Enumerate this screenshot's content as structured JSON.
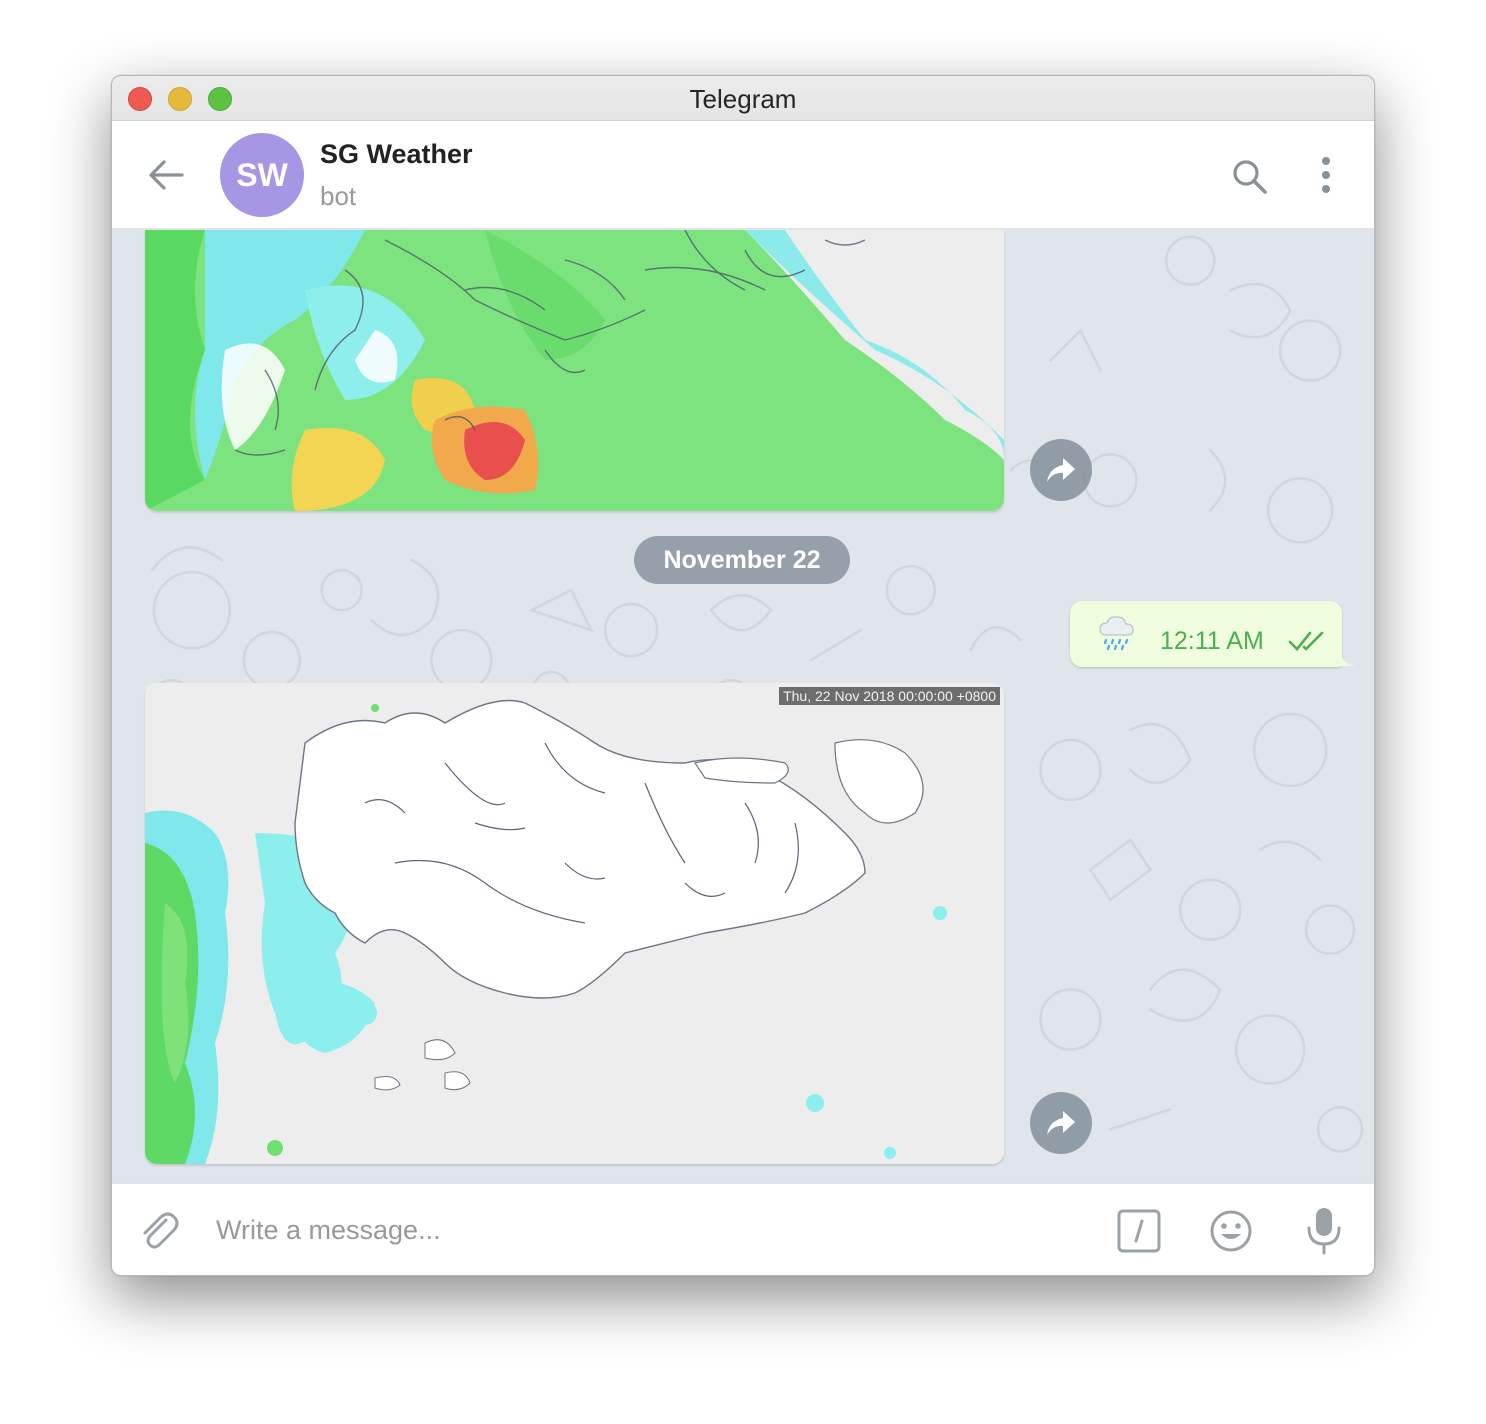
{
  "window": {
    "title": "Telegram"
  },
  "header": {
    "avatar_initials": "SW",
    "avatar_color": "#a796e4",
    "chat_name": "SG Weather",
    "chat_status": "bot",
    "back_icon": "arrow-left-icon",
    "search_icon": "search-icon",
    "more_icon": "more-vertical-icon"
  },
  "messages": [
    {
      "type": "photo",
      "direction": "incoming",
      "content": "rain radar map of Singapore",
      "forward_icon": "forward-icon"
    },
    {
      "type": "date_separator",
      "text": "November 22"
    },
    {
      "type": "text",
      "direction": "outgoing",
      "emoji": "cloud-with-rain",
      "time": "12:11 AM",
      "status": "read"
    },
    {
      "type": "photo",
      "direction": "incoming",
      "content": "rain radar map of Singapore",
      "timestamp": "Thu, 22 Nov 2018 00:00:00 +0800",
      "forward_icon": "forward-icon"
    }
  ],
  "composer": {
    "placeholder": "Write a message...",
    "attach_icon": "paperclip-icon",
    "command_icon": "slash-command-icon",
    "emoji_icon": "smiley-icon",
    "mic_icon": "microphone-icon"
  },
  "colors": {
    "chat_background": "#dfe5eb",
    "outgoing_bubble": "#effdde",
    "outgoing_time": "#4caf50",
    "date_pill": "#8894a0"
  }
}
